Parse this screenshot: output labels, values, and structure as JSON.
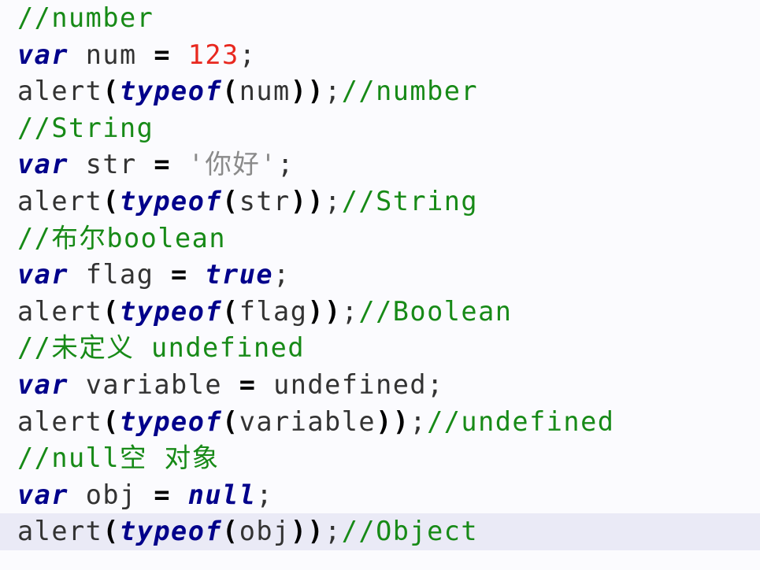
{
  "lines": [
    {
      "type": "comment",
      "comment": "//number"
    },
    {
      "type": "decl",
      "kw": "var",
      "name": "num",
      "op": "=",
      "value": "123",
      "value_kind": "num"
    },
    {
      "type": "alert",
      "fn": "alert",
      "kw": "typeof",
      "arg": "num",
      "comment": "//number"
    },
    {
      "type": "comment",
      "comment": "//String"
    },
    {
      "type": "decl",
      "kw": "var",
      "name": "str",
      "op": "=",
      "value": "'你好'",
      "value_kind": "str"
    },
    {
      "type": "alert",
      "fn": "alert",
      "kw": "typeof",
      "arg": "str",
      "comment": "//String"
    },
    {
      "type": "comment",
      "comment": "//布尔boolean"
    },
    {
      "type": "decl",
      "kw": "var",
      "name": "flag",
      "op": "=",
      "value": "true",
      "value_kind": "kw"
    },
    {
      "type": "alert",
      "fn": "alert",
      "kw": "typeof",
      "arg": "flag",
      "comment": "//Boolean"
    },
    {
      "type": "comment",
      "comment": "//未定义 undefined"
    },
    {
      "type": "decl",
      "kw": "var",
      "name": "variable",
      "op": "=",
      "value": "undefined",
      "value_kind": "id"
    },
    {
      "type": "alert",
      "fn": "alert",
      "kw": "typeof",
      "arg": "variable",
      "comment": "//undefined"
    },
    {
      "type": "comment",
      "comment": "//null空 对象"
    },
    {
      "type": "decl",
      "kw": "var",
      "name": "obj",
      "op": "=",
      "value": "null",
      "value_kind": "kw"
    },
    {
      "type": "alert",
      "fn": "alert",
      "kw": "typeof",
      "arg": "obj",
      "comment": "//Object",
      "current": true
    }
  ],
  "colors": {
    "keyword": "#00008b",
    "comment": "#178a17",
    "number": "#e8281f",
    "string": "#8a8a8a",
    "current_line": "#eaeaf6",
    "background": "#fbfbfe"
  }
}
